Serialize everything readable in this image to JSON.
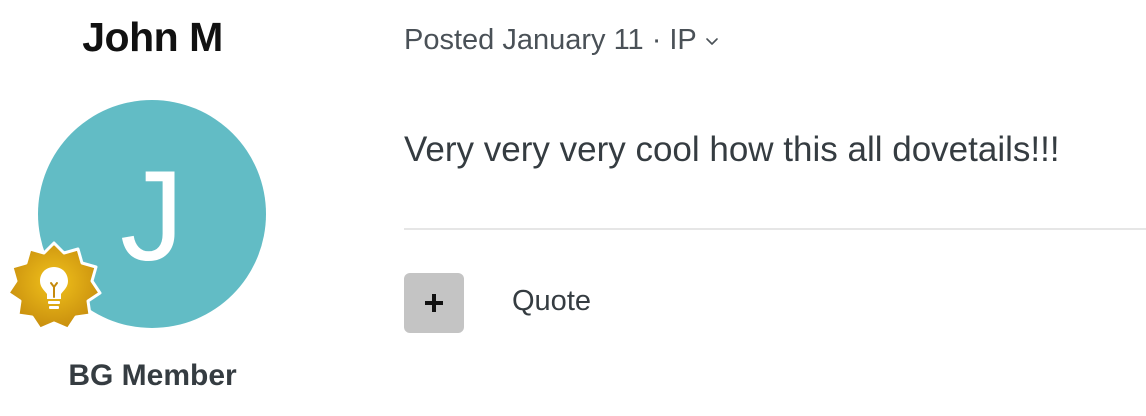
{
  "author": {
    "name": "John M",
    "avatar_letter": "J",
    "avatar_color": "#62bcc5",
    "badge_icon": "lightbulb-icon",
    "badge_color": "#d39a12",
    "role": "BG Member"
  },
  "post": {
    "posted_label": "Posted January 11",
    "separator": "·",
    "ip_label": "IP",
    "content": "Very very very cool how this all dovetails!!!"
  },
  "actions": {
    "add_icon": "plus-icon",
    "quote_label": "Quote"
  }
}
